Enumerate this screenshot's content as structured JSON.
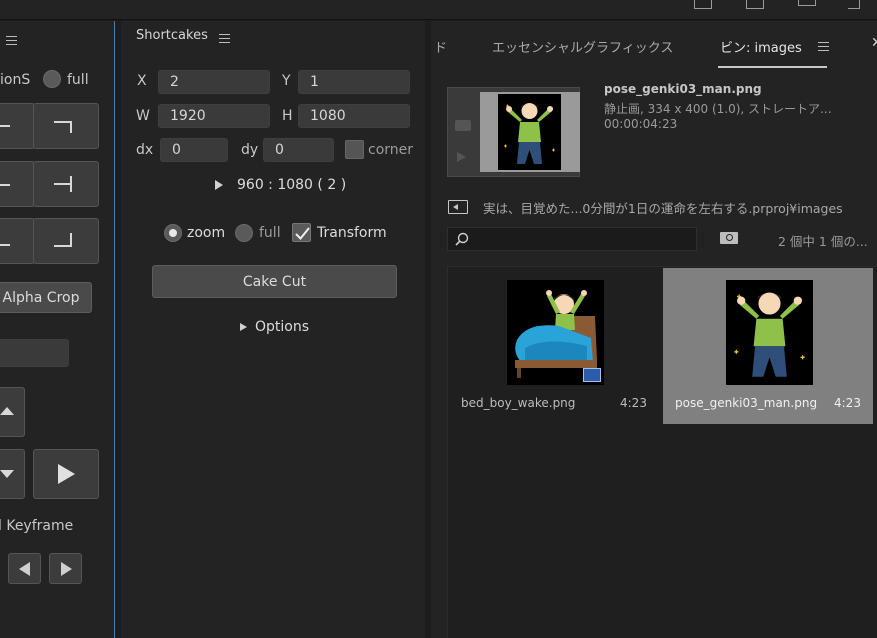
{
  "left_panel": {
    "checkbox_label": "ionS",
    "radio_full_label": "full",
    "alpha_crop_label": "Alpha Crop",
    "keyframe_label": "l Keyframe"
  },
  "mid_panel": {
    "title": "Shortcakes",
    "x_label": "X",
    "x_value": "2",
    "y_label": "Y",
    "y_value": "1",
    "w_label": "W",
    "w_value": "1920",
    "h_label": "H",
    "h_value": "1080",
    "dx_label": "dx",
    "dx_value": "0",
    "dy_label": "dy",
    "dy_value": "0",
    "corner_label": "corner",
    "size_text": "960 : 1080 ( 2 )",
    "zoom_label": "zoom",
    "full_label": "full",
    "transform_label": "Transform",
    "cake_cut_label": "Cake Cut",
    "options_label": "Options"
  },
  "right_panel": {
    "tabs": [
      "ド",
      "エッセンシャルグラフィックス",
      "ビン: images"
    ],
    "preview": {
      "filename": "pose_genki03_man.png",
      "details": "静止画, 334 x 400 (1.0), ストレートア...",
      "duration": "00:00:04:23"
    },
    "path": "実は、目覚めた...0分間が1日の運命を左右する.prproj¥images",
    "search_placeholder": "",
    "count_text": "2 個中 1 個の...",
    "items": [
      {
        "name": "bed_boy_wake.png",
        "duration": "4:23",
        "selected": false
      },
      {
        "name": "pose_genki03_man.png",
        "duration": "4:23",
        "selected": true
      }
    ]
  },
  "colors": {
    "accent_border": "#3b7fb3",
    "selected_item_bg": "#808080",
    "panel_bg": "#232323"
  }
}
